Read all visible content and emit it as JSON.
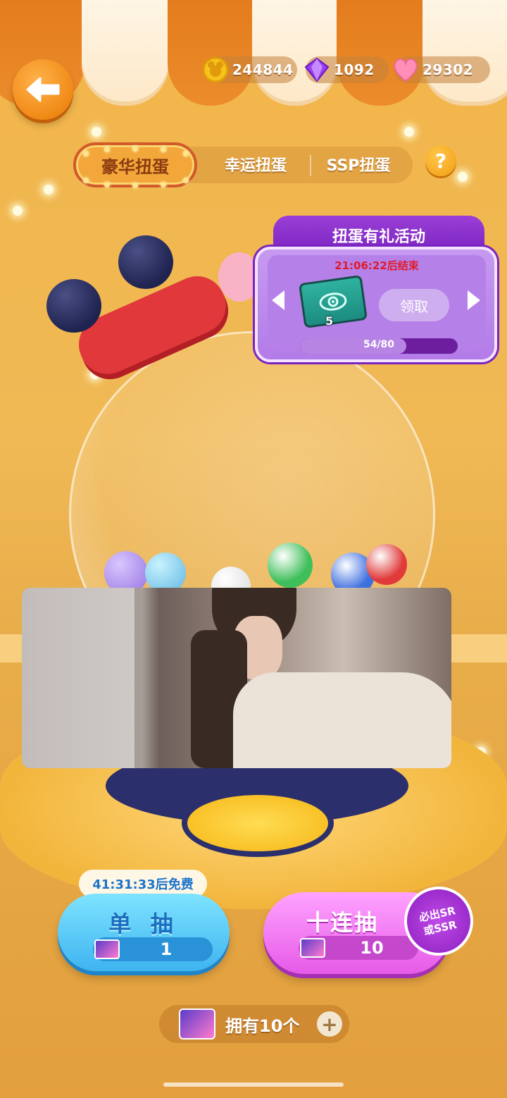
{
  "currency": {
    "coins": "244844",
    "gems": "1092",
    "hearts": "29302"
  },
  "tabs": [
    {
      "label": "豪华扭蛋",
      "active": true
    },
    {
      "label": "幸运扭蛋",
      "active": false
    },
    {
      "label": "SSP扭蛋",
      "active": false
    }
  ],
  "help_label": "?",
  "activity": {
    "title": "扭蛋有礼活动",
    "timer": "21:06:22后结束",
    "reward_count": "5",
    "claim_label": "领取",
    "progress_text": "54/80",
    "progress_fraction": 0.675
  },
  "single_draw": {
    "free_timer": "41:31:33后免费",
    "label": "单 抽",
    "cost": "1"
  },
  "ten_draw": {
    "label": "十连抽",
    "cost": "10",
    "badge_line1": "必出SR",
    "badge_line2": "或SSR"
  },
  "owned": {
    "label": "拥有10个",
    "plus": "+"
  },
  "colors": {
    "accent_orange": "#f08a16",
    "activity_purple": "#7a23c0",
    "single_blue": "#3eb4f0",
    "ten_pink": "#e65ae8"
  }
}
